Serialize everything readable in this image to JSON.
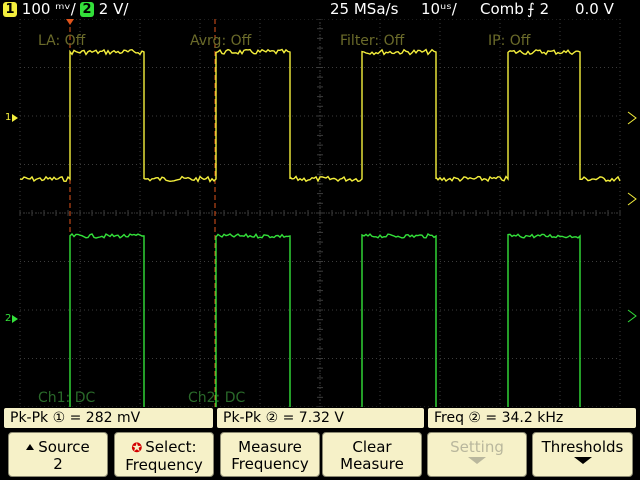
{
  "status": {
    "ch1_num": "1",
    "ch1_scale": "100 ᵐᵛ/",
    "ch2_num": "2",
    "ch2_scale": "2 V/",
    "sample_rate": "25 MSa/s",
    "timebase": "10ᵘˢ/",
    "acq_mode": "Comb",
    "trigger": "⨍ 2",
    "trigger_level": "0.0 V"
  },
  "screen": {
    "overlays": {
      "la": "LA: Off",
      "avg": "Avrg: Off",
      "filter": "Filter: Off",
      "ip": "IP: Off",
      "ch1_coupling": "Ch1: DC",
      "ch2_coupling": "Ch2: DC"
    },
    "markers": {
      "ch1_ground": "1",
      "ch2_ground": "2"
    }
  },
  "measurements": [
    {
      "label": "Pk-Pk ① = 282 mV"
    },
    {
      "label": "Pk-Pk ② =  7.32  V"
    },
    {
      "label": "Freq ② = 34.2 kHz"
    }
  ],
  "softkeys": {
    "source": {
      "line1": "Source",
      "line2": "2"
    },
    "select": {
      "line1": "Select:",
      "line2": "Frequency"
    },
    "measure": {
      "line1": "Measure",
      "line2": "Frequency"
    },
    "clear": {
      "line1": "Clear",
      "line2": "Measure"
    },
    "setting": {
      "line1": "Setting"
    },
    "thresholds": {
      "line1": "Thresholds"
    }
  },
  "colors": {
    "ch1": "#f4ef3d",
    "ch2": "#33e03a",
    "grid": "#3c3c3c",
    "softkey_bg": "#f6f1c8",
    "cursor": "#e0541c"
  }
}
